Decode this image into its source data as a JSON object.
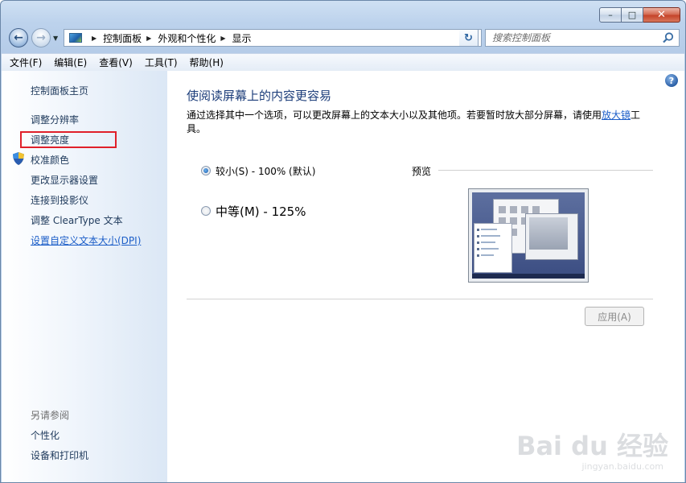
{
  "window": {
    "caption_buttons": {
      "minimize": "–",
      "maximize": "□",
      "close": "✕"
    }
  },
  "address_bar": {
    "crumbs": [
      "控制面板",
      "外观和个性化",
      "显示"
    ],
    "search_placeholder": "搜索控制面板"
  },
  "menu": [
    "文件(F)",
    "编辑(E)",
    "查看(V)",
    "工具(T)",
    "帮助(H)"
  ],
  "sidebar": {
    "home": "控制面板主页",
    "items": [
      "调整分辨率",
      "调整亮度",
      "校准颜色",
      "更改显示器设置",
      "连接到投影仪",
      "调整 ClearType 文本",
      "设置自定义文本大小(DPI)"
    ],
    "see_also_title": "另请参阅",
    "see_also": [
      "个性化",
      "设备和打印机"
    ]
  },
  "main": {
    "title": "使阅读屏幕上的内容更容易",
    "description_before": "通过选择其中一个选项，可以更改屏幕上的文本大小以及其他项。若要暂时放大部分屏幕，请使用",
    "description_link": "放大镜",
    "description_after": "工具。",
    "option_small": "较小(S) - 100% (默认)",
    "option_medium": "中等(M) - 125%",
    "option_small_selected": true,
    "preview_label": "预览",
    "apply_button": "应用(A)",
    "help_button": "?"
  },
  "watermark": {
    "brand": "Bai du 经验",
    "url": "jingyan.baidu.com"
  },
  "colors": {
    "highlight_box": "#e0202a",
    "link": "#1c5ec8",
    "title": "#1c3d7a"
  }
}
